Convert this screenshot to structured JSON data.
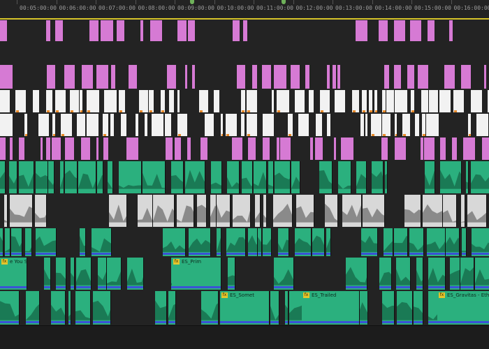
{
  "ruler": {
    "timecodes": [
      "00:05:00:00",
      "00:06:00:00",
      "00:07:00:00",
      "00:08:00:00",
      "00:09:00:00",
      "00:10:00:00",
      "00:11:00:00",
      "00:12:00:00",
      "00:13:00:00",
      "00:14:00:00",
      "00:15:00:00",
      "00:16:00:00"
    ]
  },
  "clip_labels": [
    {
      "track": 9,
      "text": "e You Sc"
    },
    {
      "track": 9,
      "text": "ES_Prim"
    },
    {
      "track": 10,
      "text": "ES_Somet"
    },
    {
      "track": 10,
      "text": "ES_Trailed"
    },
    {
      "track": 10,
      "text": "ES_Gravitas - Eth"
    }
  ],
  "colors": {
    "pink": "#d67ad4",
    "white": "#f2f2f2",
    "audio_green": "#2bb07e",
    "marker_green": "#6fb25a",
    "playhead_bar": "#d6c32a",
    "fx_badge": "#e3c52c"
  },
  "fx_badge_text": "fx"
}
